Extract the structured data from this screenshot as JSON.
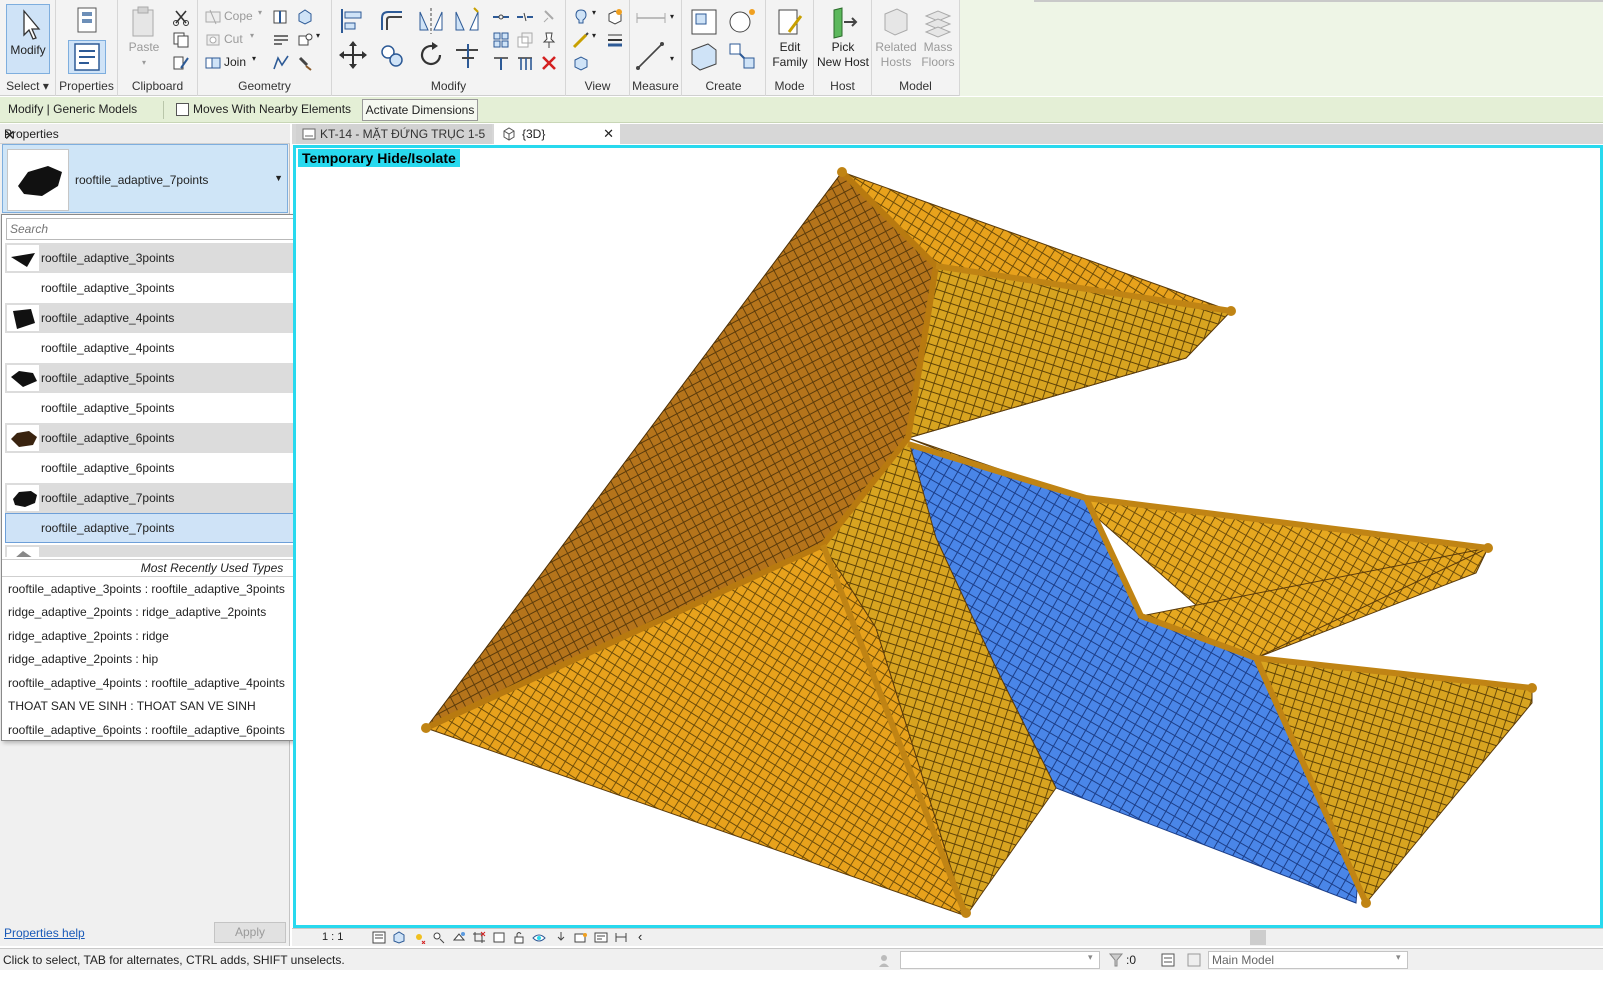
{
  "ribbon": {
    "select": {
      "modify": "Modify",
      "select_label": "Select ▾"
    },
    "properties": {
      "label": "Properties"
    },
    "clipboard": {
      "paste": "Paste",
      "label": "Clipboard"
    },
    "geometry": {
      "cope": "Cope",
      "cut": "Cut",
      "join": "Join",
      "label": "Geometry"
    },
    "modify": {
      "label": "Modify"
    },
    "view": {
      "label": "View"
    },
    "measure": {
      "label": "Measure"
    },
    "create": {
      "label": "Create"
    },
    "mode": {
      "edit_family_1": "Edit",
      "edit_family_2": "Family",
      "label": "Mode"
    },
    "host": {
      "pick_1": "Pick",
      "pick_2": "New Host",
      "label": "Host"
    },
    "model": {
      "related_1": "Related",
      "related_2": "Hosts",
      "mass_1": "Mass",
      "mass_2": "Floors",
      "label": "Model"
    }
  },
  "options_bar": {
    "context": "Modify | Generic Models",
    "moves_with": "Moves With Nearby Elements",
    "activate_dimensions": "Activate Dimensions"
  },
  "properties_panel": {
    "title": "Properties",
    "current_type": "rooftile_adaptive_7points",
    "help": "Properties help",
    "apply": "Apply"
  },
  "dropdown": {
    "search_placeholder": "Search",
    "items": [
      {
        "label": "rooftile_adaptive_3points",
        "kind": "family"
      },
      {
        "label": "rooftile_adaptive_3points",
        "kind": "type"
      },
      {
        "label": "rooftile_adaptive_4points",
        "kind": "family"
      },
      {
        "label": "rooftile_adaptive_4points",
        "kind": "type"
      },
      {
        "label": "rooftile_adaptive_5points",
        "kind": "family"
      },
      {
        "label": "rooftile_adaptive_5points",
        "kind": "type"
      },
      {
        "label": "rooftile_adaptive_6points",
        "kind": "family"
      },
      {
        "label": "rooftile_adaptive_6points",
        "kind": "type"
      },
      {
        "label": "rooftile_adaptive_7points",
        "kind": "family"
      },
      {
        "label": "rooftile_adaptive_7points",
        "kind": "selected"
      }
    ],
    "mru_title": "Most Recently Used Types",
    "mru": [
      "rooftile_adaptive_3points : rooftile_adaptive_3points",
      "ridge_adaptive_2points : ridge_adaptive_2points",
      "ridge_adaptive_2points : ridge",
      "ridge_adaptive_2points : hip",
      "rooftile_adaptive_4points : rooftile_adaptive_4points",
      "THOAT SAN VE SINH : THOAT SAN VE SINH",
      "rooftile_adaptive_6points : rooftile_adaptive_6points"
    ]
  },
  "tabs": [
    {
      "label": "KT-14 - MẶT ĐỨNG TRỤC 1-5"
    },
    {
      "label": "{3D}"
    }
  ],
  "viewport": {
    "banner": "Temporary Hide/Isolate",
    "accent": "#28d9ee",
    "roof_orange": "#e8a21c",
    "roof_dark": "#b5741b",
    "roof_blue": "#4a86e8"
  },
  "view_control": {
    "scale": "1 : 1"
  },
  "status": {
    "message": "Click to select, TAB for alternates, CTRL adds, SHIFT unselects.",
    "filter_count": ":0",
    "model": "Main Model"
  }
}
